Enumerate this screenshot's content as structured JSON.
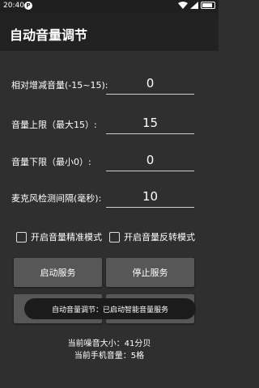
{
  "status_bar": {
    "time": "20:40",
    "notification_icon": "P"
  },
  "app_bar": {
    "title": "自动音量调节"
  },
  "fields": [
    {
      "label": "相对增减音量(-15~15):",
      "value": "0"
    },
    {
      "label": "音量上限（最大15）:",
      "value": "15"
    },
    {
      "label": "音量下限（最小0）:",
      "value": "0"
    },
    {
      "label": "麦克风检测间隔(毫秒):",
      "value": "10"
    }
  ],
  "checkboxes": [
    {
      "label": "开启音量精准模式",
      "checked": false
    },
    {
      "label": "开启音量反转模式",
      "checked": false
    }
  ],
  "buttons": {
    "start": "启动服务",
    "stop": "停止服务"
  },
  "toast": "自动音量调节：已启动智能音量服务",
  "info": {
    "noise": "当前噪音大小：41分贝",
    "volume": "当前手机音量：5格"
  },
  "colors": {
    "background": "#2f2f2f",
    "app_bar": "#222222",
    "button": "#575757"
  }
}
